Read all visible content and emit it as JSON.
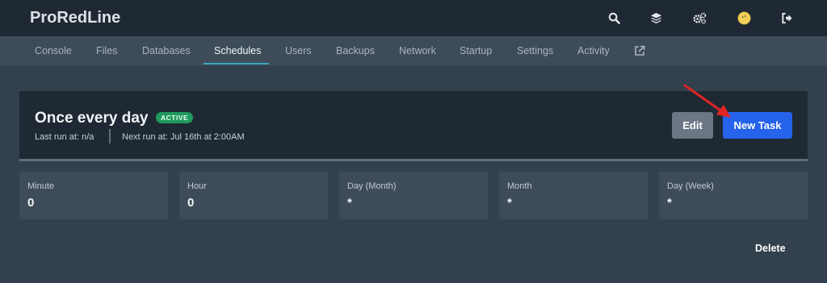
{
  "app": {
    "brand": "ProRedLine"
  },
  "header": {
    "icons": [
      "search-icon",
      "layers-icon",
      "gears-icon",
      "user-avatar-icon",
      "logout-icon"
    ]
  },
  "nav": {
    "tabs": [
      "Console",
      "Files",
      "Databases",
      "Schedules",
      "Users",
      "Backups",
      "Network",
      "Startup",
      "Settings",
      "Activity"
    ],
    "active_tab": "Schedules",
    "external_icon": "external-link-icon"
  },
  "schedule": {
    "name": "Once every day",
    "status": "ACTIVE",
    "last_run": "Last run at: n/a",
    "next_run": "Next run at: Jul 16th at 2:00AM",
    "edit_label": "Edit",
    "new_task_label": "New Task",
    "delete_label": "Delete"
  },
  "cron": [
    {
      "label": "Minute",
      "value": "0"
    },
    {
      "label": "Hour",
      "value": "0"
    },
    {
      "label": "Day (Month)",
      "value": "*"
    },
    {
      "label": "Month",
      "value": "*"
    },
    {
      "label": "Day (Week)",
      "value": "*"
    }
  ],
  "colors": {
    "topbar": "#1f2933",
    "navbar": "#3e4c59",
    "background": "#33404d",
    "accent": "#3ba7bd",
    "primary_button": "#2663eb",
    "active_badge": "#1f9a5e",
    "annotation_arrow": "#e02424"
  }
}
